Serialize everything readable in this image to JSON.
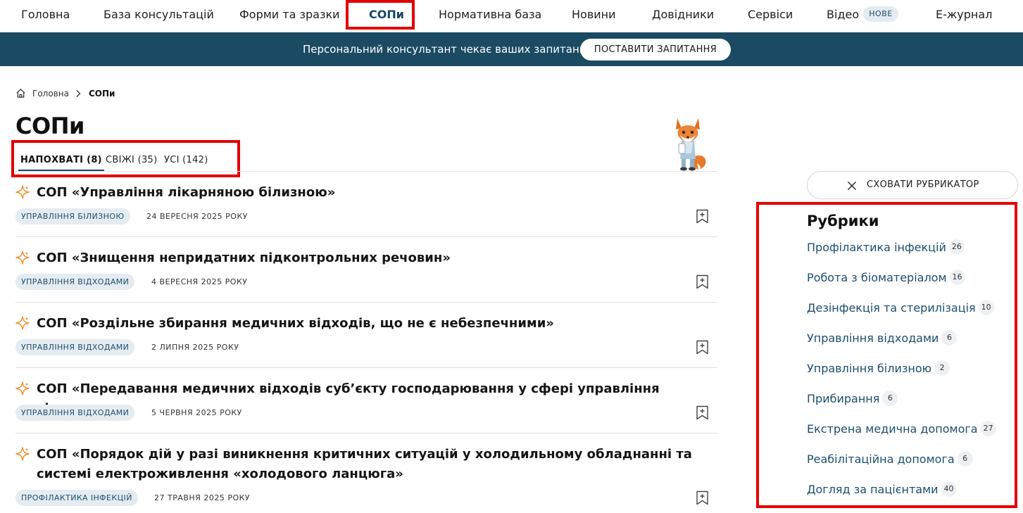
{
  "nav": {
    "items": [
      {
        "label": "Головна"
      },
      {
        "label": "База консультацій"
      },
      {
        "label": "Форми та зразки"
      },
      {
        "label": "СОПи"
      },
      {
        "label": "Нормативна база"
      },
      {
        "label": "Новини"
      },
      {
        "label": "Довідники"
      },
      {
        "label": "Сервіси"
      },
      {
        "label": "Відео"
      },
      {
        "label": "Е-журнал"
      }
    ],
    "new_badge": "НОВЕ",
    "active_index": 3
  },
  "banner": {
    "text": "Персональний консультант чекає ваших запитань",
    "button_label": "ПОСТАВИТИ ЗАПИТАННЯ"
  },
  "breadcrumb": {
    "home": "Головна",
    "current": "СОПи"
  },
  "page_title": "СОПи",
  "tabs": [
    {
      "label": "НАПОХВАТІ (8)",
      "active": true
    },
    {
      "label": "СВІЖІ (35)",
      "active": false
    },
    {
      "label": "УСІ (142)",
      "active": false
    }
  ],
  "items": [
    {
      "title": "СОП «Управління лікарняною білизною»",
      "tag": "УПРАВЛІННЯ БІЛИЗНОЮ",
      "date": "24 ВЕРЕСНЯ 2025 РОКУ"
    },
    {
      "title": "СОП «Знищення непридатних підконтрольних речовин»",
      "tag": "УПРАВЛІННЯ ВІДХОДАМИ",
      "date": "4 ВЕРЕСНЯ 2025 РОКУ"
    },
    {
      "title": "СОП «Роздільне збирання медичних відходів, що не є небезпечними»",
      "tag": "УПРАВЛІННЯ ВІДХОДАМИ",
      "date": "2 ЛИПНЯ 2025 РОКУ"
    },
    {
      "title": "СОП «Передавання медичних відходів суб’єкту господарювання у сфері управління відходами»",
      "tag": "УПРАВЛІННЯ ВІДХОДАМИ",
      "date": "5 ЧЕРВНЯ 2025 РОКУ"
    },
    {
      "title": "СОП «Порядок дій у разі виникнення критичних ситуацій у холодильному обладнанні та системі електроживлення «холодового ланцюга»",
      "tag": "ПРОФІЛАКТИКА ІНФЕКЦІЙ",
      "date": "27 ТРАВНЯ 2025 РОКУ"
    }
  ],
  "sidebar": {
    "hide_button": "СХОВАТИ РУБРИКАТОР",
    "rubrics_title": "Рубрики",
    "rubrics": [
      {
        "label": "Профілактика інфекцій",
        "count": "26"
      },
      {
        "label": "Робота з біоматеріалом",
        "count": "16"
      },
      {
        "label": "Дезінфекція та стерилізація",
        "count": "10"
      },
      {
        "label": "Управління відходами",
        "count": "6"
      },
      {
        "label": "Управління білизною",
        "count": "2"
      },
      {
        "label": "Прибирання",
        "count": "6"
      },
      {
        "label": "Екстрена медична допомога",
        "count": "27"
      },
      {
        "label": "Реабілітаційна допомога",
        "count": "6"
      },
      {
        "label": "Догляд за пацієнтами",
        "count": "40"
      }
    ]
  },
  "colors": {
    "accent": "#16456a",
    "banner_bg": "#1b4a63",
    "highlight": "#e30000",
    "spark": "#f08a24",
    "tag_bg": "#e5ecf1"
  }
}
